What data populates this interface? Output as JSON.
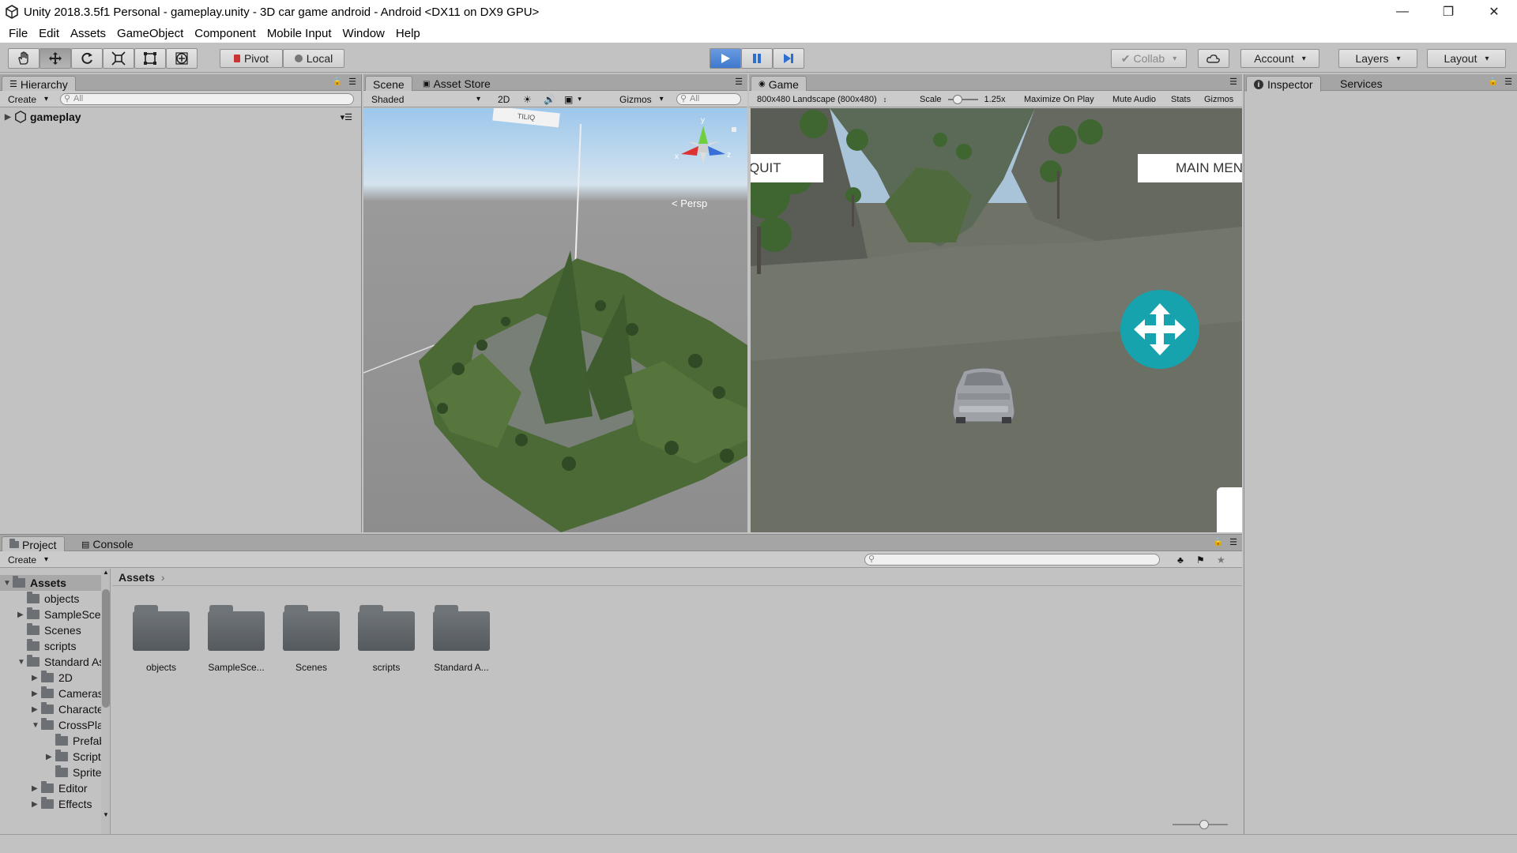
{
  "window": {
    "title": "Unity 2018.3.5f1 Personal - gameplay.unity - 3D car game android - Android <DX11 on DX9 GPU>",
    "controls": {
      "minimize": "—",
      "restore": "❐",
      "close": "✕"
    }
  },
  "menu": [
    "File",
    "Edit",
    "Assets",
    "GameObject",
    "Component",
    "Mobile Input",
    "Window",
    "Help"
  ],
  "toolbar": {
    "pivot": "Pivot",
    "local": "Local",
    "collab": "Collab",
    "account": "Account",
    "layers": "Layers",
    "layout": "Layout",
    "play_state": "playing"
  },
  "hierarchy": {
    "tab": "Hierarchy",
    "create": "Create",
    "search_placeholder": "All",
    "scene_name": "gameplay"
  },
  "scene": {
    "tabs": [
      "Scene",
      "Asset Store"
    ],
    "shading": "Shaded",
    "mode_2d": "2D",
    "gizmos": "Gizmos",
    "search_placeholder": "All",
    "projection": "Persp",
    "gizmo_axes": {
      "y": "y",
      "x": "x",
      "z": "z"
    },
    "floating_label": "TILIQ"
  },
  "game": {
    "tab": "Game",
    "resolution": "800x480 Landscape (800x480)",
    "scale_label": "Scale",
    "scale_value": "1.25x",
    "maximize": "Maximize On Play",
    "mute": "Mute Audio",
    "stats": "Stats",
    "gizmos": "Gizmos",
    "quit_button": "QUIT",
    "main_menu_button": "MAIN MENU"
  },
  "inspector": {
    "tab": "Inspector",
    "services_tab": "Services"
  },
  "project": {
    "tabs": [
      "Project",
      "Console"
    ],
    "create": "Create",
    "breadcrumb": "Assets",
    "tree": [
      {
        "label": "Assets",
        "depth": 0,
        "expanded": true,
        "arrow": true
      },
      {
        "label": "objects",
        "depth": 1,
        "expanded": false,
        "arrow": false
      },
      {
        "label": "SampleScenes",
        "depth": 1,
        "expanded": false,
        "arrow": true
      },
      {
        "label": "Scenes",
        "depth": 1,
        "expanded": false,
        "arrow": false
      },
      {
        "label": "scripts",
        "depth": 1,
        "expanded": false,
        "arrow": false
      },
      {
        "label": "Standard Assets",
        "depth": 1,
        "expanded": true,
        "arrow": true
      },
      {
        "label": "2D",
        "depth": 2,
        "expanded": false,
        "arrow": true
      },
      {
        "label": "Cameras",
        "depth": 2,
        "expanded": false,
        "arrow": true
      },
      {
        "label": "Characters",
        "depth": 2,
        "expanded": false,
        "arrow": true
      },
      {
        "label": "CrossPlatformInput",
        "depth": 2,
        "expanded": true,
        "arrow": true
      },
      {
        "label": "Prefabs",
        "depth": 3,
        "expanded": false,
        "arrow": false
      },
      {
        "label": "Scripts",
        "depth": 3,
        "expanded": false,
        "arrow": true
      },
      {
        "label": "Sprites",
        "depth": 3,
        "expanded": false,
        "arrow": false
      },
      {
        "label": "Editor",
        "depth": 2,
        "expanded": false,
        "arrow": true
      },
      {
        "label": "Effects",
        "depth": 2,
        "expanded": false,
        "arrow": true
      }
    ],
    "grid_items": [
      "objects",
      "SampleSce...",
      "Scenes",
      "scripts",
      "Standard A..."
    ]
  },
  "colors": {
    "editor_bg": "#c2c2c2",
    "play_active": "#3f79cd",
    "terrain": "#4a6a36",
    "move_pad": "#16a3ad"
  },
  "icons": [
    "hand-tool-icon",
    "move-tool-icon",
    "rotate-tool-icon",
    "scale-tool-icon",
    "rect-tool-icon",
    "transform-tool-icon",
    "play-icon",
    "pause-icon",
    "step-icon",
    "cloud-icon",
    "lock-icon",
    "folder-icon",
    "move-arrows-icon"
  ]
}
